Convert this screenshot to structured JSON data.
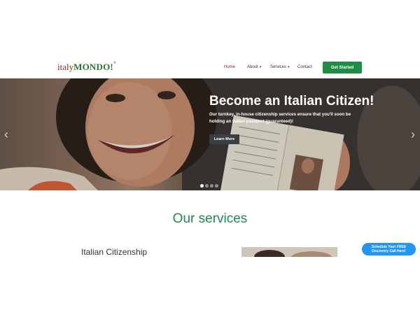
{
  "logo": {
    "part_a": "italy",
    "part_b": "MONDO!",
    "mark": "®"
  },
  "nav": {
    "items": [
      {
        "label": "Home",
        "active": true
      },
      {
        "label": "About",
        "caret": "▾"
      },
      {
        "label": "Services",
        "caret": "▾"
      },
      {
        "label": "Contact"
      }
    ],
    "cta_label": "Get Started"
  },
  "hero": {
    "title": "Become an Italian Citizen!",
    "subtitle": "Our turnkey, in-house citizenship services ensure that you'll soon be holding an Italian passport (guaranteed)!",
    "button_label": "Learn More",
    "prev_icon": "‹",
    "next_icon": "›",
    "slide_count": 4,
    "active_slide": 1
  },
  "services": {
    "title": "Our services",
    "first_heading": "Italian Citizenship"
  },
  "schedule": {
    "line1": "Schedule Your FREE",
    "line2": "Discovery Call Here!"
  },
  "colors": {
    "brand_green": "#1e8c45",
    "brand_red": "#8b1e1e",
    "schedule_blue": "#2196f3",
    "services_title": "#1f8b4c"
  }
}
